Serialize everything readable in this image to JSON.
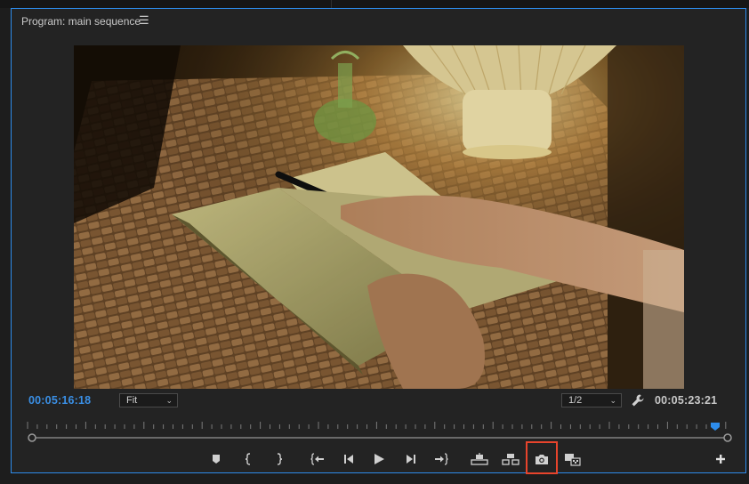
{
  "panel": {
    "title": "Program: main sequence",
    "menu_icon": "hamburger-menu-icon"
  },
  "viewer": {
    "frame_description_icon": "video-frame"
  },
  "timecode": {
    "current": "00:05:16:18",
    "duration": "00:05:23:21"
  },
  "zoom": {
    "value": "Fit"
  },
  "resolution": {
    "value": "1/2"
  },
  "settings_icon": "wrench-icon",
  "transport": {
    "buttons": [
      {
        "name": "add-marker-button",
        "icon": "marker-icon"
      },
      {
        "name": "mark-in-button",
        "icon": "mark-in-icon"
      },
      {
        "name": "mark-out-button",
        "icon": "mark-out-icon"
      },
      {
        "name": "go-to-in-button",
        "icon": "go-to-in-icon"
      },
      {
        "name": "step-back-button",
        "icon": "step-back-icon"
      },
      {
        "name": "play-button",
        "icon": "play-icon"
      },
      {
        "name": "step-forward-button",
        "icon": "step-forward-icon"
      },
      {
        "name": "go-to-out-button",
        "icon": "go-to-out-icon"
      },
      {
        "name": "lift-button",
        "icon": "lift-icon"
      },
      {
        "name": "extract-button",
        "icon": "extract-icon"
      },
      {
        "name": "export-frame-button",
        "icon": "camera-icon"
      },
      {
        "name": "comparison-view-button",
        "icon": "comparison-view-icon"
      },
      {
        "name": "button-editor-button",
        "icon": "plus-icon"
      }
    ]
  },
  "colors": {
    "accent": "#2d8ceb",
    "timecode": "#3a8fe5",
    "highlight": "#e8442c",
    "panel_bg": "#232323"
  }
}
